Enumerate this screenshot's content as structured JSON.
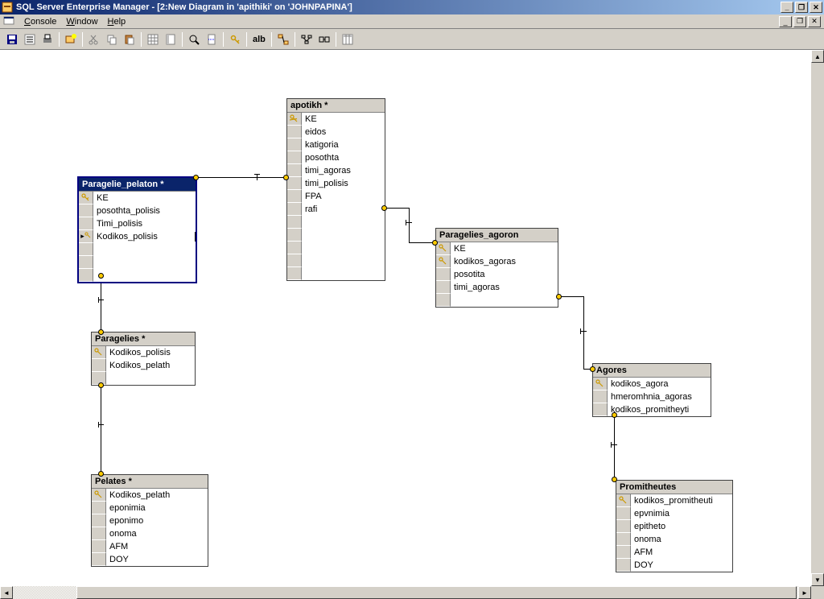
{
  "window": {
    "title": "SQL Server Enterprise Manager - [2:New Diagram in 'apithiki' on 'JOHNPAPINA']"
  },
  "menu": {
    "console": "Console",
    "window": "Window",
    "help": "Help"
  },
  "toolbar": {
    "ab_label": "alb"
  },
  "tables": {
    "paragelie_pelaton": {
      "title": "Paragelie_pelaton *",
      "cols": [
        {
          "name": "KE",
          "key": true
        },
        {
          "name": "posothta_polisis",
          "key": false
        },
        {
          "name": "Timi_polisis",
          "key": false
        },
        {
          "name": "Kodikos_polisis",
          "key": true,
          "editing": true
        }
      ]
    },
    "apotikh": {
      "title": "apotikh *",
      "cols": [
        {
          "name": "KE",
          "key": true
        },
        {
          "name": "eidos",
          "key": false
        },
        {
          "name": "katigoria",
          "key": false
        },
        {
          "name": "posothta",
          "key": false
        },
        {
          "name": "timi_agoras",
          "key": false
        },
        {
          "name": "timi_polisis",
          "key": false
        },
        {
          "name": "FPA",
          "key": false
        },
        {
          "name": "rafi",
          "key": false
        }
      ]
    },
    "paragelies_agoron": {
      "title": "Paragelies_agoron",
      "cols": [
        {
          "name": "KE",
          "key": true
        },
        {
          "name": "kodikos_agoras",
          "key": true
        },
        {
          "name": "posotita",
          "key": false
        },
        {
          "name": "timi_agoras",
          "key": false
        }
      ]
    },
    "paragelies": {
      "title": "Paragelies *",
      "cols": [
        {
          "name": "Kodikos_polisis",
          "key": true
        },
        {
          "name": "Kodikos_pelath",
          "key": false
        }
      ]
    },
    "agores": {
      "title": "Agores",
      "cols": [
        {
          "name": "kodikos_agora",
          "key": true
        },
        {
          "name": "hmeromhnia_agoras",
          "key": false
        },
        {
          "name": "kodikos_promitheyti",
          "key": false
        }
      ]
    },
    "pelates": {
      "title": "Pelates *",
      "cols": [
        {
          "name": "Kodikos_pelath",
          "key": true
        },
        {
          "name": "eponimia",
          "key": false
        },
        {
          "name": "eponimo",
          "key": false
        },
        {
          "name": "onoma",
          "key": false
        },
        {
          "name": "AFM",
          "key": false
        },
        {
          "name": "DOY",
          "key": false
        }
      ]
    },
    "promitheutes": {
      "title": "Promitheutes",
      "cols": [
        {
          "name": "kodikos_promitheuti",
          "key": true
        },
        {
          "name": "epvnimia",
          "key": false
        },
        {
          "name": "epitheto",
          "key": false
        },
        {
          "name": "onoma",
          "key": false
        },
        {
          "name": "AFM",
          "key": false
        },
        {
          "name": "DOY",
          "key": false
        }
      ]
    }
  }
}
